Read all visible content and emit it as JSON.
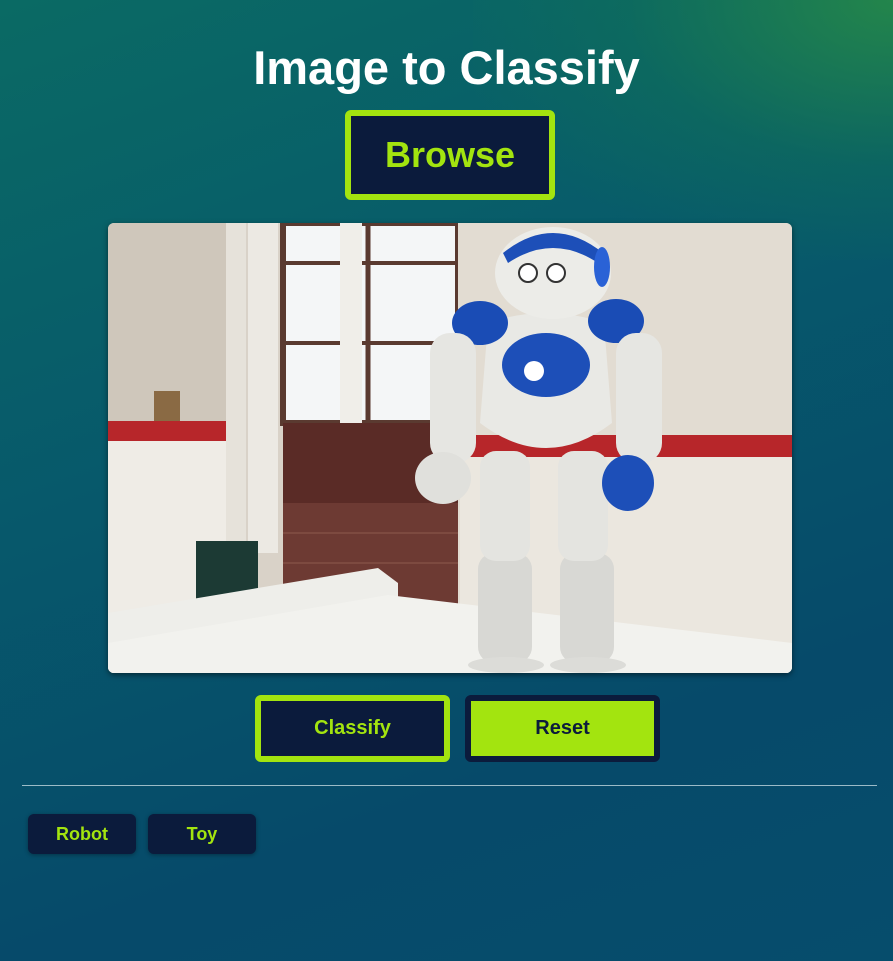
{
  "header": {
    "title": "Image to Classify"
  },
  "upload": {
    "browse_label": "Browse"
  },
  "preview": {
    "alt": "Photo of a white and blue humanoid robot standing on a table in a room"
  },
  "actions": {
    "classify_label": "Classify",
    "reset_label": "Reset"
  },
  "results": {
    "labels": [
      "Robot",
      "Toy"
    ]
  },
  "colors": {
    "accent": "#a3e40f",
    "button_dark": "#0b1b3c",
    "title": "#ffffff"
  }
}
